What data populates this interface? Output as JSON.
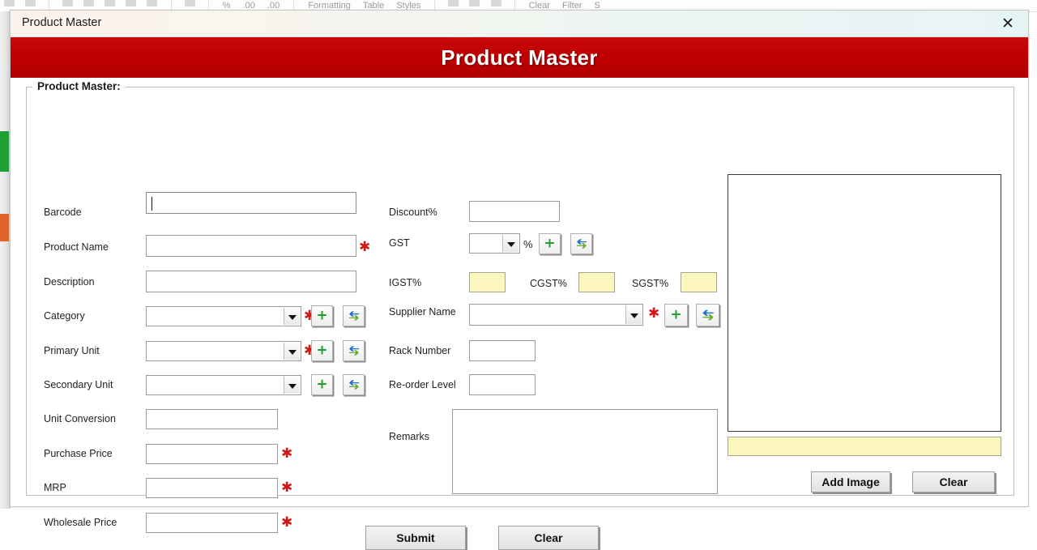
{
  "background": {
    "app": "spreadsheet",
    "ribbon_items": [
      "Formatting",
      "Table",
      "Styles",
      "Clear",
      "Filter",
      "S"
    ],
    "ribbon_numbers": [
      "%",
      ".00",
      ".00"
    ]
  },
  "window": {
    "title": "Product Master",
    "close_icon": "close-icon",
    "close_label": "✕"
  },
  "header": {
    "title": "Product Master",
    "background_color": "#c00000",
    "text_color": "#ffffff"
  },
  "group": {
    "legend": "Product Master:"
  },
  "colors": {
    "accent_red": "#c00000",
    "required_star": "#d31717",
    "yellow_field": "#fbf6bd",
    "plus_green": "#1f9f2f",
    "arrow_blue": "#1f6fd0",
    "arrow_green": "#69ab2d"
  },
  "left_column": [
    {
      "label": "Barcode",
      "type": "text",
      "value": "",
      "required": false,
      "focused": true
    },
    {
      "label": "Product Name",
      "type": "text",
      "value": "",
      "required": true
    },
    {
      "label": "Description",
      "type": "text",
      "value": "",
      "required": false
    },
    {
      "label": "Category",
      "type": "combo",
      "value": "",
      "required": true,
      "add": true,
      "refresh": true
    },
    {
      "label": "Primary Unit",
      "type": "combo",
      "value": "",
      "required": true,
      "add": true,
      "refresh": true
    },
    {
      "label": "Secondary Unit",
      "type": "combo",
      "value": "",
      "required": false,
      "add": true,
      "refresh": true
    },
    {
      "label": "Unit Conversion",
      "type": "text",
      "value": "",
      "required": false
    },
    {
      "label": "Purchase Price",
      "type": "text",
      "value": "",
      "required": true
    },
    {
      "label": "MRP",
      "type": "text",
      "value": "",
      "required": true
    },
    {
      "label": "Wholesale Price",
      "type": "text",
      "value": "",
      "required": true
    }
  ],
  "middle_column": {
    "discount": {
      "label": "Discount%",
      "value": ""
    },
    "gst": {
      "label": "GST",
      "value": "",
      "suffix": "%",
      "add": true,
      "refresh": true
    },
    "igst": {
      "label": "IGST%",
      "value": ""
    },
    "cgst": {
      "label": "CGST%",
      "value": ""
    },
    "sgst": {
      "label": "SGST%",
      "value": ""
    },
    "supplier": {
      "label": "Supplier Name",
      "value": "",
      "required": true,
      "add": true,
      "refresh": true
    },
    "rack": {
      "label": "Rack Number",
      "value": ""
    },
    "reorder": {
      "label": "Re-order Level",
      "value": ""
    },
    "remarks": {
      "label": "Remarks",
      "value": ""
    }
  },
  "image_panel": {
    "preview_value": "",
    "path_value": "",
    "add_button": "Add Image",
    "clear_button": "Clear"
  },
  "footer": {
    "submit_button": "Submit",
    "clear_button": "Clear"
  },
  "icons": {
    "add": "plus-icon",
    "refresh": "refresh-arrows-icon",
    "dropdown": "chevron-down-icon",
    "required": "required-asterisk-icon"
  }
}
